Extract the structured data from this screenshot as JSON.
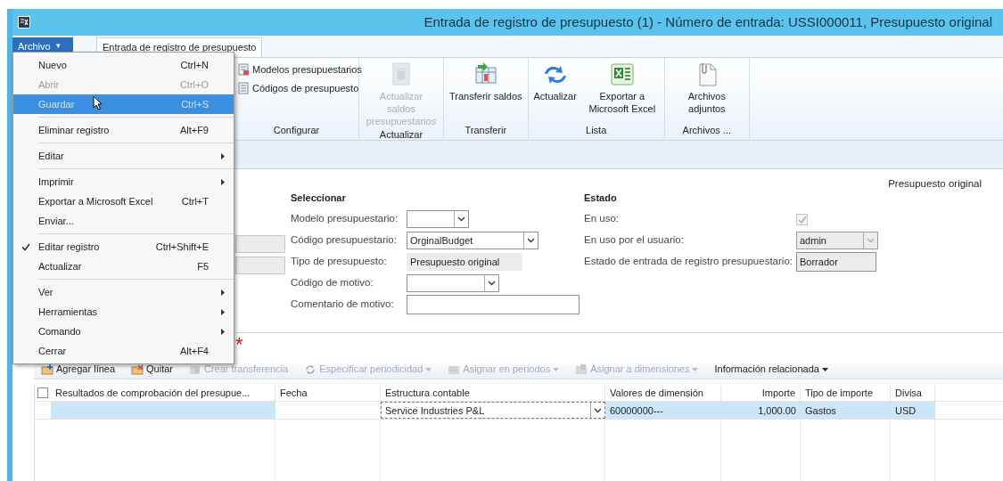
{
  "window": {
    "title": "Entrada de registro de presupuesto (1) - Número de entrada: USSI000011, Presupuesto original"
  },
  "file_button": {
    "label": "Archivo",
    "symbol": "▾"
  },
  "tabs": [
    {
      "label": "Entrada de registro de presupuesto",
      "selected": true
    }
  ],
  "ribbon": {
    "groups": [
      {
        "label": "Configurar",
        "buttons": [
          {
            "kind": "small",
            "label": "Modelos presupuestarios",
            "disabled": false
          },
          {
            "kind": "small",
            "label": "Códigos de presupuesto",
            "disabled": false
          }
        ]
      },
      {
        "label": "Actualizar",
        "buttons": [
          {
            "kind": "large",
            "label": "Actualizar saldos presupuestarios",
            "disabled": true
          }
        ]
      },
      {
        "label": "Transferir",
        "buttons": [
          {
            "kind": "large",
            "label": "Transferir saldos",
            "disabled": false
          }
        ]
      },
      {
        "label": "Lista",
        "buttons": [
          {
            "kind": "large",
            "label": "Actualizar",
            "disabled": false
          },
          {
            "kind": "large",
            "label": "Exportar a Microsoft Excel",
            "disabled": false
          }
        ]
      },
      {
        "label": "Archivos ...",
        "buttons": [
          {
            "kind": "large",
            "label": "Archivos adjuntos",
            "disabled": false
          }
        ]
      }
    ]
  },
  "file_menu": [
    {
      "kind": "item",
      "label": "Nuevo",
      "shortcut": "Ctrl+N",
      "disabled": false,
      "selected": false,
      "checked": false,
      "submenu": false
    },
    {
      "kind": "item",
      "label": "Abrir",
      "shortcut": "Ctrl+O",
      "disabled": true,
      "selected": false,
      "checked": false,
      "submenu": false
    },
    {
      "kind": "item",
      "label": "Guardar",
      "shortcut": "Ctrl+S",
      "disabled": true,
      "selected": true,
      "checked": false,
      "submenu": false
    },
    {
      "kind": "separator"
    },
    {
      "kind": "item",
      "label": "Eliminar registro",
      "shortcut": "Alt+F9",
      "disabled": false,
      "selected": false,
      "checked": false,
      "submenu": false
    },
    {
      "kind": "separator"
    },
    {
      "kind": "item",
      "label": "Editar",
      "disabled": false,
      "selected": false,
      "checked": false,
      "submenu": true
    },
    {
      "kind": "separator"
    },
    {
      "kind": "item",
      "label": "Imprimir",
      "disabled": false,
      "selected": false,
      "checked": false,
      "submenu": true
    },
    {
      "kind": "item",
      "label": "Exportar a Microsoft Excel",
      "shortcut": "Ctrl+T",
      "disabled": false,
      "selected": false,
      "checked": false,
      "submenu": false
    },
    {
      "kind": "item",
      "label": "Enviar...",
      "disabled": false,
      "selected": false,
      "checked": false,
      "submenu": false
    },
    {
      "kind": "separator"
    },
    {
      "kind": "item",
      "label": "Editar registro",
      "shortcut": "Ctrl+Shift+E",
      "disabled": false,
      "selected": false,
      "checked": true,
      "submenu": false
    },
    {
      "kind": "item",
      "label": "Actualizar",
      "shortcut": "F5",
      "disabled": false,
      "selected": false,
      "checked": false,
      "submenu": false
    },
    {
      "kind": "separator"
    },
    {
      "kind": "item",
      "label": "Ver",
      "disabled": false,
      "selected": false,
      "checked": false,
      "submenu": true
    },
    {
      "kind": "item",
      "label": "Herramientas",
      "disabled": false,
      "selected": false,
      "checked": false,
      "submenu": true
    },
    {
      "kind": "item",
      "label": "Comando",
      "disabled": false,
      "selected": false,
      "checked": false,
      "submenu": true
    },
    {
      "kind": "item",
      "label": "Cerrar",
      "shortcut": "Alt+F4",
      "disabled": false,
      "selected": false,
      "checked": false,
      "submenu": false
    }
  ],
  "header_caption": "Presupuesto original",
  "left_fields": [
    {
      "kind": "readonly"
    },
    {
      "kind": "readonly"
    }
  ],
  "select_section": {
    "title": "Seleccionar",
    "fields": [
      {
        "label": "Modelo presupuestario:",
        "kind": "combo"
      },
      {
        "label": "Código presupuestario:",
        "kind": "combo",
        "value": "OrginalBudget"
      },
      {
        "label": "Tipo de presupuesto:",
        "kind": "readonly",
        "value": "Presupuesto original"
      },
      {
        "label": "Código de motivo:",
        "kind": "combo"
      },
      {
        "label": "Comentario de motivo:",
        "kind": "text"
      }
    ]
  },
  "status_section": {
    "title": "Estado",
    "fields": [
      {
        "label": "En uso:",
        "kind": "check",
        "checked": true
      },
      {
        "label": "En uso por el usuario:",
        "kind": "combo_readonly",
        "value": "admin"
      },
      {
        "label": "Estado de entrada de registro presupuestario:",
        "kind": "readonly_boxed",
        "value": "Borrador"
      }
    ]
  },
  "required_mark": "*",
  "grid_toolbar": [
    {
      "label": "Agregar línea",
      "disabled": false,
      "dropdown": false
    },
    {
      "label": "Quitar",
      "disabled": false,
      "dropdown": false
    },
    {
      "label": "Crear transferencia",
      "disabled": true,
      "dropdown": false
    },
    {
      "label": "Especificar periodicidad",
      "disabled": true,
      "dropdown": true
    },
    {
      "label": "Asignar en periodos",
      "disabled": true,
      "dropdown": true
    },
    {
      "label": "Asignar a dimensiones",
      "disabled": true,
      "dropdown": true
    },
    {
      "label": "Información relacionada",
      "disabled": false,
      "dropdown": true
    }
  ],
  "table": {
    "select_all_checked": false,
    "columns": [
      {
        "label": "Resultados de comprobación del presupue...",
        "kind": "text"
      },
      {
        "label": "Fecha",
        "kind": "text"
      },
      {
        "label": "Estructura contable",
        "kind": "text"
      },
      {
        "label": "Valores de dimensión",
        "kind": "text"
      },
      {
        "label": "Importe",
        "kind": "amount"
      },
      {
        "label": "Tipo de importe",
        "kind": "text"
      },
      {
        "label": "Divisa",
        "kind": "text"
      }
    ],
    "rows": [
      {
        "selected": true,
        "cells": [
          {
            "kind": "fill"
          },
          {
            "kind": "plain"
          },
          {
            "kind": "combo",
            "text": "Service Industries P&L"
          },
          {
            "kind": "text",
            "text": "60000000---"
          },
          {
            "kind": "text",
            "text": "1,000.00"
          },
          {
            "kind": "text",
            "text": "Gastos"
          },
          {
            "kind": "text",
            "text": "USD"
          }
        ]
      }
    ]
  }
}
